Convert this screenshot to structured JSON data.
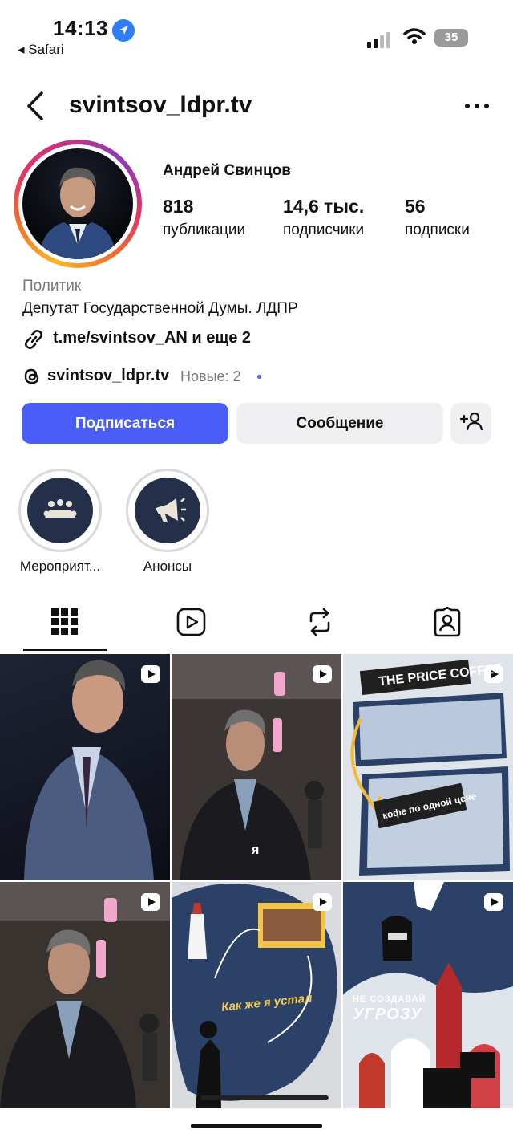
{
  "status_bar": {
    "time": "14:13",
    "back_app": "◂ Safari",
    "battery": "35"
  },
  "header": {
    "username": "svintsov_ldpr.tv"
  },
  "profile": {
    "full_name": "Андрей Свинцов",
    "stats": [
      {
        "value": "818",
        "label": "публикации"
      },
      {
        "value": "14,6 тыс.",
        "label": "подписчики"
      },
      {
        "value": "56",
        "label": "подписки"
      }
    ],
    "category": "Политик",
    "bio": "Депутат Государственной Думы. ЛДПР",
    "link": "t.me/svintsov_AN и еще 2",
    "threads": {
      "name": "svintsov_ldpr.tv",
      "new_label": "Новые: 2"
    }
  },
  "actions": {
    "follow": "Подписаться",
    "message": "Сообщение"
  },
  "highlights": [
    {
      "label": "Мероприят..."
    },
    {
      "label": "Анонсы"
    }
  ],
  "tabs": [
    "posts-grid",
    "reels",
    "reposts",
    "tagged"
  ],
  "posts": [
    {
      "type": "reel",
      "caption": ""
    },
    {
      "type": "reel",
      "caption": "я"
    },
    {
      "type": "reel",
      "caption_top": "THE PRICE COFFEE",
      "caption": "кофе по одной цене"
    },
    {
      "type": "reel",
      "caption": ""
    },
    {
      "type": "reel",
      "caption": "Как же я устал"
    },
    {
      "type": "reel",
      "caption_small": "НЕ СОЗДАВАЙ",
      "caption": "УГРОЗУ"
    }
  ],
  "colors": {
    "follow_button": "#4a5df7",
    "secondary_button": "#efeff2",
    "highlight_bg": "#243049",
    "muted_text": "#777777"
  }
}
